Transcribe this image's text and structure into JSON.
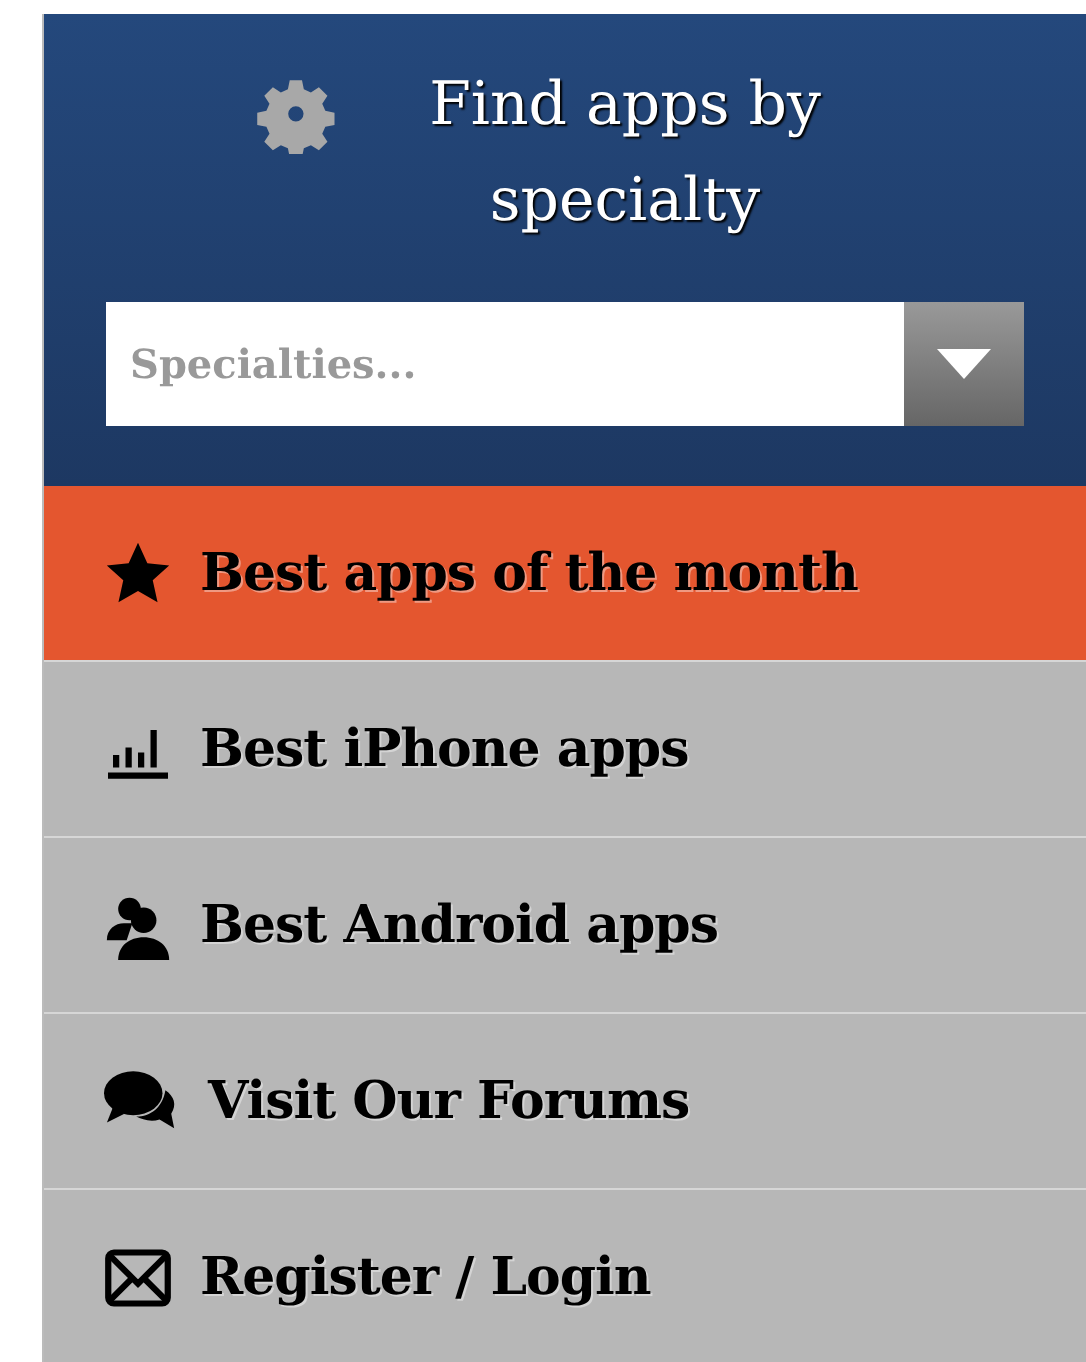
{
  "header": {
    "title": "Find apps by specialty"
  },
  "specialty_select": {
    "placeholder": "Specialties..."
  },
  "menu": [
    {
      "label": "Best apps of the month",
      "selected": true
    },
    {
      "label": "Best iPhone apps",
      "selected": false
    },
    {
      "label": "Best Android apps",
      "selected": false
    },
    {
      "label": "Visit Our Forums",
      "selected": false
    },
    {
      "label": "Register / Login",
      "selected": false
    }
  ]
}
